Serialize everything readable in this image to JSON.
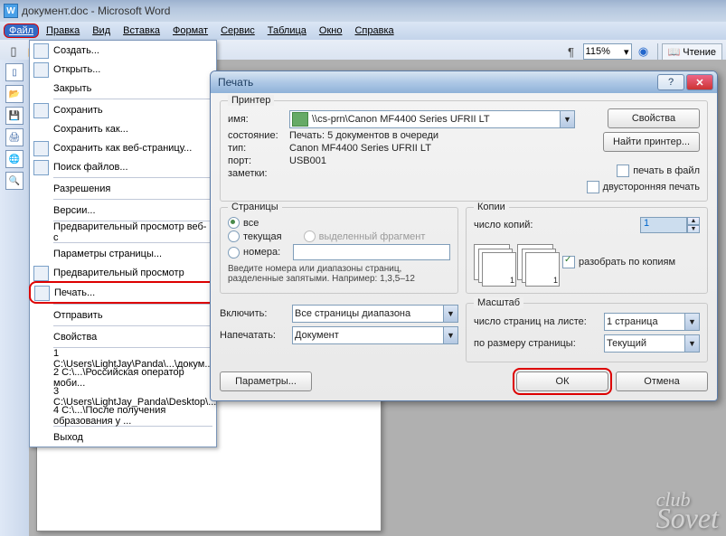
{
  "title": "документ.doc - Microsoft Word",
  "menubar": [
    "Файл",
    "Правка",
    "Вид",
    "Вставка",
    "Формат",
    "Сервис",
    "Таблица",
    "Окно",
    "Справка"
  ],
  "zoom": "115%",
  "reading_label": "Чтение",
  "file_menu": {
    "create": "Создать...",
    "open": "Открыть...",
    "close": "Закрыть",
    "save": "Сохранить",
    "save_as": "Сохранить как...",
    "save_web": "Сохранить как веб-страницу...",
    "search": "Поиск файлов...",
    "perm": "Разрешения",
    "versions": "Версии...",
    "webpreview": "Предварительный просмотр веб-с",
    "page_setup": "Параметры страницы...",
    "preview": "Предварительный просмотр",
    "print": "Печать...",
    "send": "Отправить",
    "props": "Свойства",
    "r1": "1 C:\\Users\\LightJay\\Panda\\...\\докум...",
    "r2": "2 C:\\...\\Российская оператор моби...",
    "r3": "3 C:\\Users\\LightJay_Panda\\Desktop\\...",
    "r4": "4 C:\\...\\После получения образования у ...",
    "exit": "Выход"
  },
  "dlg": {
    "title": "Печать",
    "printer": {
      "group": "Принтер",
      "name_lbl": "имя:",
      "name_val": "\\\\cs-prn\\Canon MF4400 Series UFRII LT",
      "state_lbl": "состояние:",
      "state_val": "Печать: 5 документов в очереди",
      "type_lbl": "тип:",
      "type_val": "Canon MF4400 Series UFRII LT",
      "port_lbl": "порт:",
      "port_val": "USB001",
      "notes_lbl": "заметки:",
      "props_btn": "Свойства",
      "find_btn": "Найти принтер...",
      "tofile": "печать в файл",
      "duplex": "двусторонняя печать"
    },
    "pages": {
      "group": "Страницы",
      "all": "все",
      "current": "текущая",
      "selection": "выделенный фрагмент",
      "numbers": "номера:",
      "hint1": "Введите номера или диапазоны страниц,",
      "hint2": "разделенные запятыми. Например: 1,3,5–12"
    },
    "copies": {
      "group": "Копии",
      "count_lbl": "число копий:",
      "count_val": "1",
      "collate": "разобрать по копиям"
    },
    "include_lbl": "Включить:",
    "include_val": "Все страницы диапазона",
    "printwhat_lbl": "Напечатать:",
    "printwhat_val": "Документ",
    "scale": {
      "group": "Масштаб",
      "perpage_lbl": "число страниц на листе:",
      "perpage_val": "1 страница",
      "fit_lbl": "по размеру страницы:",
      "fit_val": "Текущий"
    },
    "params_btn": "Параметры...",
    "ok": "ОК",
    "cancel": "Отмена"
  },
  "watermark": {
    "a": "club",
    "b": "Sovet"
  }
}
